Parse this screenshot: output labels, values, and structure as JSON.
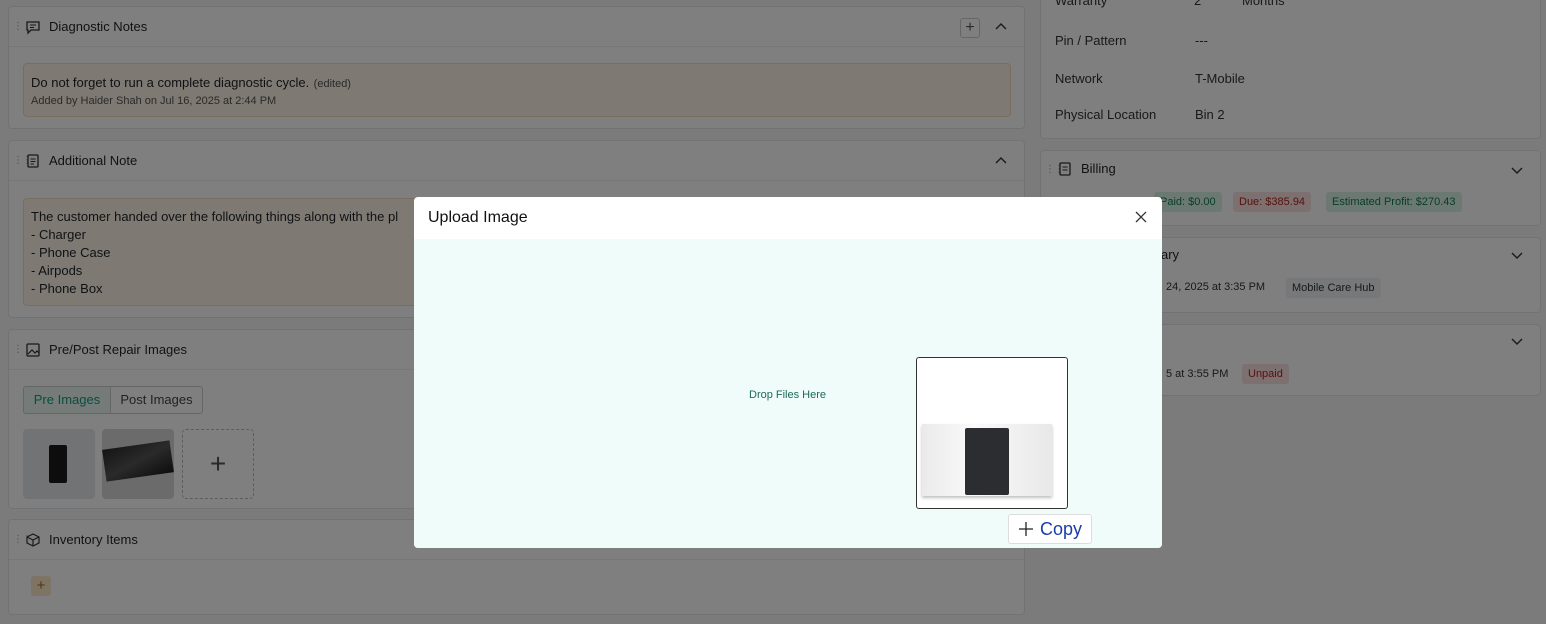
{
  "left": {
    "diagnostic_notes": {
      "title": "Diagnostic Notes",
      "note_text": "Do not forget to run a complete diagnostic cycle.",
      "note_edited": "(edited)",
      "note_meta": "Added by Haider Shah on Jul 16, 2025 at 2:44 PM"
    },
    "additional_note": {
      "title": "Additional Note",
      "lines": [
        "The customer handed over the following things along with the pl",
        "- Charger",
        "- Phone Case",
        "- Airpods",
        "- Phone Box"
      ]
    },
    "repair_images": {
      "title": "Pre/Post Repair Images",
      "tabs": [
        "Pre Images",
        "Post Images"
      ],
      "add_symbol": "+"
    },
    "inventory": {
      "title": "Inventory Items",
      "add_symbol": "+"
    }
  },
  "right": {
    "details": [
      {
        "label": "Warranty",
        "value": "2",
        "unit": "Months"
      },
      {
        "label": "Pin / Pattern",
        "value": "---"
      },
      {
        "label": "Network",
        "value": "T-Mobile"
      },
      {
        "label": "Physical Location",
        "value": "Bin 2"
      }
    ],
    "billing": {
      "title": "Billing",
      "paid": "Paid: $0.00",
      "due": "Due: $385.94",
      "profit": "Estimated Profit: $270.43"
    },
    "summary": {
      "title_fragment": "ary",
      "date_fragment": "24, 2025 at 3:35 PM",
      "store": "Mobile Care Hub"
    },
    "third": {
      "date_fragment": "5 at 3:55 PM",
      "status": "Unpaid"
    }
  },
  "modal": {
    "title": "Upload Image",
    "drop_text": "Drop Files Here",
    "copy_label": "Copy"
  },
  "colors": {
    "accent": "#1a9a7a",
    "paid_bg": "#d8f3e6",
    "due_bg": "#fbe0e0",
    "due_text": "#b42318"
  }
}
